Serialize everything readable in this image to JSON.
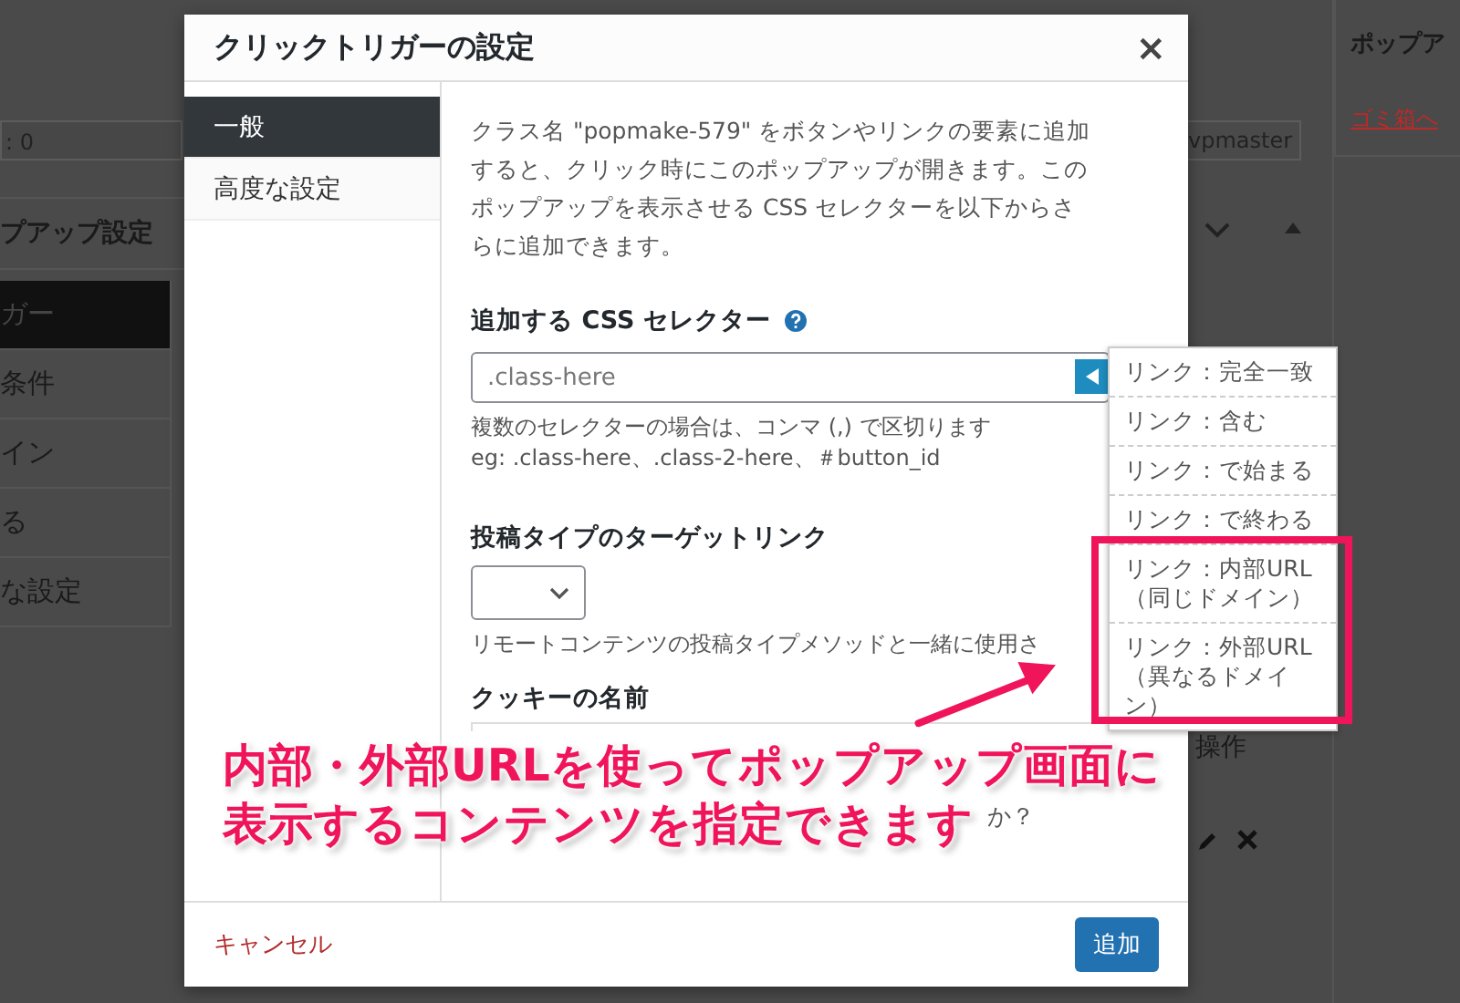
{
  "background": {
    "left_panel": {
      "field_value": ": 0",
      "title": "プアップ設定",
      "items": [
        {
          "label": "ガー",
          "selected": true
        },
        {
          "label": "条件",
          "selected": false
        },
        {
          "label": "イン",
          "selected": false
        },
        {
          "label": "る",
          "selected": false
        },
        {
          "label": "な設定",
          "selected": false
        }
      ]
    },
    "middle": {
      "author": "vpmaster",
      "column_header": "操作"
    },
    "right_panel": {
      "heading": "ポップア",
      "trash_link": "ゴミ箱へ"
    }
  },
  "dialog": {
    "title": "クリックトリガーの設定",
    "close": "×",
    "tabs": [
      {
        "label": "一般",
        "selected": true
      },
      {
        "label": "高度な設定",
        "selected": false
      }
    ],
    "description": "クラス名 \"popmake-579\" をボタンやリンクの要素に追加すると、クリック時にこのポップアップが開きます。このポップアップを表示させる CSS セレクターを以下からさらに追加できます。",
    "css_selector": {
      "label": "追加する CSS セレクター",
      "placeholder": ".class-here",
      "help": "複数のセレクターの場合は、コンマ (,) で区切ります",
      "example": "eg: .class-here、.class-2-here、＃button_id"
    },
    "post_type_link": {
      "label": "投稿タイプのターゲットリンク",
      "help": "リモートコンテンツの投稿タイプメソッドと一緒に使用さ"
    },
    "cookie": {
      "label": "クッキーの名前",
      "trailing_text": "か？"
    },
    "cancel": "キャンセル",
    "submit": "追加"
  },
  "dropdown": {
    "options": [
      "リンク：完全一致",
      "リンク：含む",
      "リンク：で始まる",
      "リンク：で終わる",
      "リンク：内部URL（同じドメイン）",
      "リンク：外部URL（異なるドメイン）"
    ]
  },
  "annotation": {
    "lines": [
      "内部・外部URLを使ってポップアップ画面に",
      "表示するコンテンツを指定できます"
    ]
  }
}
